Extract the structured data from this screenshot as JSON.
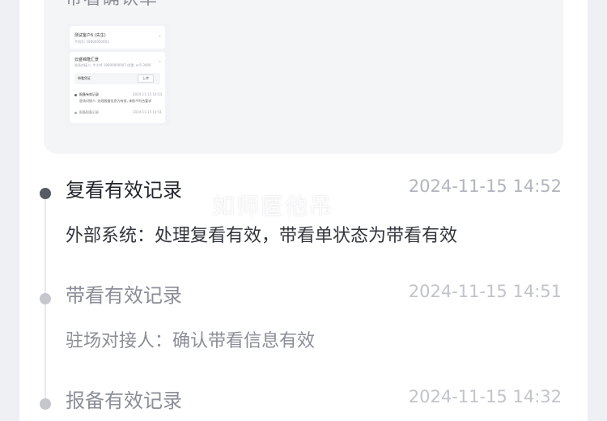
{
  "confirm_section": {
    "title": "带看确认单",
    "thumbnail": {
      "customer_name": "测试客户6 (先生)",
      "customer_phone": "手机号: 18800000003",
      "project_name": "云盛锦隆汇景",
      "project_meta": "驻场对接人: 牛大师 18800000007 优惠: ac5-3000",
      "voucher_label": "带看凭证",
      "upload_label": "上传",
      "record1_title": "报备有效记录",
      "record1_time": "2024-11-15 14:53",
      "record1_desc": "驻场对接人: 处理报备信息为有效, 来航不符合要求",
      "record2_title": "报备报备记录",
      "record2_time": "2024-11-15 14:51"
    }
  },
  "timeline": {
    "items": [
      {
        "title": "复看有效记录",
        "time": "2024-11-15 14:52",
        "desc": "外部系统：处理复看有效，带看单状态为带看有效",
        "active": true
      },
      {
        "title": "带看有效记录",
        "time": "2024-11-15 14:51",
        "desc": "驻场对接人：确认带看信息有效",
        "active": false
      },
      {
        "title": "报备有效记录",
        "time": "2024-11-15 14:32",
        "desc": "",
        "active": false
      }
    ]
  },
  "watermark": "如师匿他吊",
  "colors": {
    "background": "#eef0f4",
    "card": "#ffffff",
    "panel": "#f4f5f7",
    "active_dot": "#555a63",
    "inactive_dot": "#c5c7cc",
    "active_title": "#1f2329",
    "inactive_title": "#8b8e96",
    "time": "#b2b5bc",
    "active_desc": "#33363c",
    "inactive_desc": "#8b8e96"
  }
}
